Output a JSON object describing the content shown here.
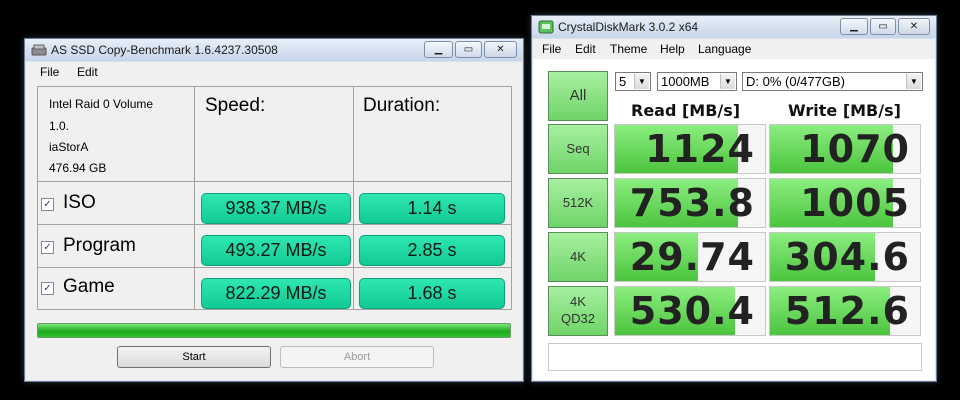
{
  "asssd": {
    "title": "AS SSD Copy-Benchmark 1.6.4237.30508",
    "menu": [
      "File",
      "Edit"
    ],
    "drive_info": [
      "Intel Raid 0 Volume",
      "1.0.",
      "iaStorA",
      "476.94 GB"
    ],
    "headers": {
      "speed": "Speed:",
      "duration": "Duration:"
    },
    "rows": [
      {
        "label": "ISO",
        "checked": true,
        "speed": "938.37 MB/s",
        "duration": "1.14 s"
      },
      {
        "label": "Program",
        "checked": true,
        "speed": "493.27 MB/s",
        "duration": "2.85 s"
      },
      {
        "label": "Game",
        "checked": true,
        "speed": "822.29 MB/s",
        "duration": "1.68 s"
      }
    ],
    "progress": 1.0,
    "buttons": {
      "start": "Start",
      "abort": "Abort"
    }
  },
  "cdm": {
    "title": "CrystalDiskMark 3.0.2 x64",
    "menu": [
      "File",
      "Edit",
      "Theme",
      "Help",
      "Language"
    ],
    "all_button": "All",
    "count": "5",
    "size": "1000MB",
    "drive": "D: 0% (0/477GB)",
    "headers": {
      "read": "Read [MB/s]",
      "write": "Write [MB/s]"
    },
    "rows": [
      {
        "label_lines": [
          "Seq"
        ],
        "read": "1124",
        "write": "1070",
        "read_fill": 0.82,
        "write_fill": 0.82
      },
      {
        "label_lines": [
          "512K"
        ],
        "read": "753.8",
        "write": "1005",
        "read_fill": 0.82,
        "write_fill": 0.82
      },
      {
        "label_lines": [
          "4K"
        ],
        "read": "29.74",
        "write": "304.6",
        "read_fill": 0.55,
        "write_fill": 0.7
      },
      {
        "label_lines": [
          "4K",
          "QD32"
        ],
        "read": "530.4",
        "write": "512.6",
        "read_fill": 0.8,
        "write_fill": 0.8
      }
    ]
  },
  "colors": {
    "as_result": "#1fd6a1",
    "as_progress": "#2cc32c",
    "cdm_fill": "#5fd452"
  }
}
